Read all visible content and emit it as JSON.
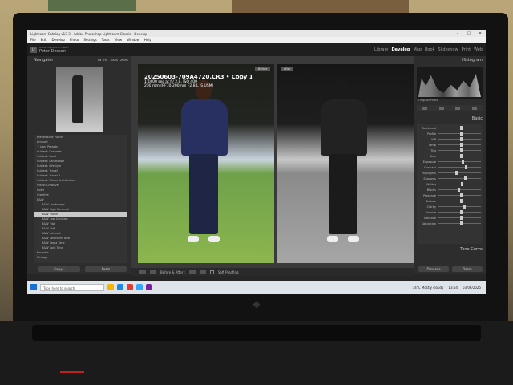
{
  "window": {
    "title": "Lightroom Catalog-v13-3 - Adobe Photoshop Lightroom Classic - Develop",
    "controls": [
      "–",
      "□",
      "✕"
    ]
  },
  "menu": [
    "File",
    "Edit",
    "Develop",
    "Photo",
    "Settings",
    "Tools",
    "View",
    "Window",
    "Help"
  ],
  "identity": {
    "subtitle": "Adobe Lightroom Classic",
    "name": "Peter Dessen"
  },
  "modules": [
    "Library",
    "Develop",
    "Map",
    "Book",
    "Slideshow",
    "Print",
    "Web"
  ],
  "active_module": "Develop",
  "left_panel": {
    "navigator_label": "Navigator",
    "zoom_options": [
      "Fit",
      "Fill",
      "100%",
      "200%"
    ],
    "presets": [
      {
        "label": "Preset  B&W Punch",
        "indent": false,
        "selected": false
      },
      {
        "label": "Amount",
        "indent": false,
        "selected": false
      },
      {
        "label": "+ User Presets",
        "indent": false,
        "selected": false
      },
      {
        "label": "Subject: Concerts",
        "indent": false,
        "selected": false
      },
      {
        "label": "Subject: Food",
        "indent": false,
        "selected": false
      },
      {
        "label": "Subject: Landscape",
        "indent": false,
        "selected": false
      },
      {
        "label": "Subject: Lifestyle",
        "indent": false,
        "selected": false
      },
      {
        "label": "Subject: Travel",
        "indent": false,
        "selected": false
      },
      {
        "label": "Subject: Travel II",
        "indent": false,
        "selected": false
      },
      {
        "label": "Subject: Urban Architecture",
        "indent": false,
        "selected": false
      },
      {
        "label": "Video: Creative",
        "indent": false,
        "selected": false
      },
      {
        "label": "Color",
        "indent": false,
        "selected": false
      },
      {
        "label": "Creative",
        "indent": false,
        "selected": false
      },
      {
        "label": "B&W",
        "indent": false,
        "selected": false
      },
      {
        "label": "B&W Landscape",
        "indent": true,
        "selected": false
      },
      {
        "label": "B&W High Contrast",
        "indent": true,
        "selected": false
      },
      {
        "label": "B&W Punch",
        "indent": true,
        "selected": true
      },
      {
        "label": "B&W Low Contrast",
        "indent": true,
        "selected": false
      },
      {
        "label": "B&W Flat",
        "indent": true,
        "selected": false
      },
      {
        "label": "B&W Soft",
        "indent": true,
        "selected": false
      },
      {
        "label": "B&W Infrared",
        "indent": true,
        "selected": false
      },
      {
        "label": "B&W Selenium Tone",
        "indent": true,
        "selected": false
      },
      {
        "label": "B&W Sepia Tone",
        "indent": true,
        "selected": false
      },
      {
        "label": "B&W Split Tone",
        "indent": true,
        "selected": false
      },
      {
        "label": "Portraits",
        "indent": false,
        "selected": false
      },
      {
        "label": "Vintage",
        "indent": false,
        "selected": false
      }
    ],
    "copy_button": "Copy...",
    "paste_button": "Paste"
  },
  "center": {
    "filename": "20250603-709A4720.CR3  •  Copy 1",
    "exposure": "1/1000 sec at f / 2.8, ISO 400",
    "lens": "200 mm (RF70-200mm F2.8 L IS USM)",
    "before_label": "Before",
    "after_label": "After",
    "toolbar_label": "Before & After :",
    "softproof_label": "Soft Proofing"
  },
  "right_panel": {
    "histogram_label": "Histogram",
    "original_photo": "Original Photo",
    "basic_label": "Basic",
    "sliders": [
      {
        "label": "Treatment",
        "value": "",
        "pos": 0.5
      },
      {
        "label": "Profile",
        "value": "",
        "pos": 0.5
      },
      {
        "label": "WB",
        "value": "",
        "pos": 0.5
      },
      {
        "label": "Temp",
        "value": "",
        "pos": 0.5
      },
      {
        "label": "Tint",
        "value": "",
        "pos": 0.5
      },
      {
        "label": "Tone",
        "value": "",
        "pos": 0.5
      },
      {
        "label": "Exposure",
        "value": "",
        "pos": 0.55
      },
      {
        "label": "Contrast",
        "value": "",
        "pos": 0.62
      },
      {
        "label": "Highlights",
        "value": "",
        "pos": 0.4
      },
      {
        "label": "Shadows",
        "value": "",
        "pos": 0.6
      },
      {
        "label": "Whites",
        "value": "",
        "pos": 0.52
      },
      {
        "label": "Blacks",
        "value": "",
        "pos": 0.45
      },
      {
        "label": "Presence",
        "value": "",
        "pos": 0.5
      },
      {
        "label": "Texture",
        "value": "",
        "pos": 0.5
      },
      {
        "label": "Clarity",
        "value": "",
        "pos": 0.58
      },
      {
        "label": "Dehaze",
        "value": "",
        "pos": 0.5
      },
      {
        "label": "Vibrance",
        "value": "",
        "pos": 0.5
      },
      {
        "label": "Saturation",
        "value": "",
        "pos": 0.5
      }
    ],
    "tone_curve_label": "Tone Curve",
    "previous_button": "Previous",
    "reset_button": "Reset"
  },
  "taskbar": {
    "search_placeholder": "Type here to search",
    "weather": "14°C  Mostly cloudy",
    "time": "13:54",
    "date": "03/06/2025"
  },
  "colors": {
    "lightroom_bg": "#262626",
    "panel_bg": "#2d2d2d",
    "taskbar_bg": "#dfe3ea"
  }
}
